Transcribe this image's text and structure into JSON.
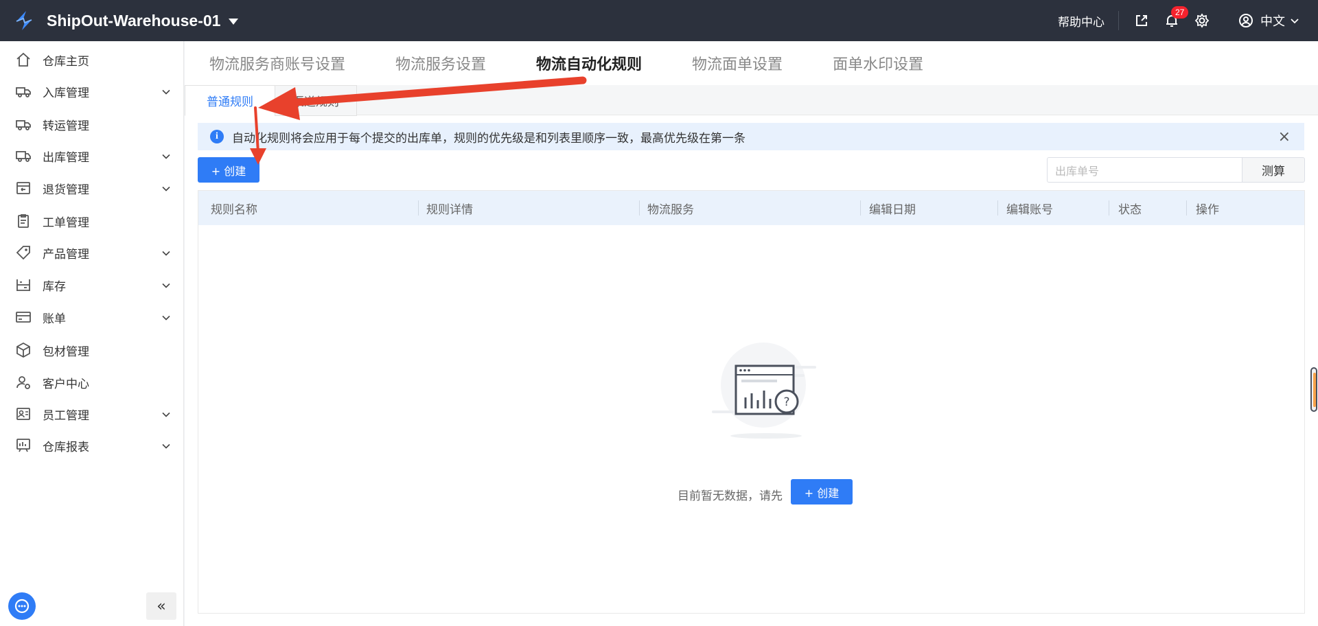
{
  "header": {
    "warehouse_name": "ShipOut-Warehouse-01",
    "help_center": "帮助中心",
    "notification_count": "27",
    "language": "中文"
  },
  "sidebar": {
    "items": [
      {
        "label": "仓库主页",
        "icon": "home-icon",
        "expandable": false
      },
      {
        "label": "入库管理",
        "icon": "inbound-truck-icon",
        "expandable": true
      },
      {
        "label": "转运管理",
        "icon": "transfer-truck-icon",
        "expandable": false
      },
      {
        "label": "出库管理",
        "icon": "outbound-truck-icon",
        "expandable": true
      },
      {
        "label": "退货管理",
        "icon": "return-box-icon",
        "expandable": true
      },
      {
        "label": "工单管理",
        "icon": "clipboard-icon",
        "expandable": false
      },
      {
        "label": "产品管理",
        "icon": "tag-icon",
        "expandable": true
      },
      {
        "label": "库存",
        "icon": "shelf-icon",
        "expandable": true
      },
      {
        "label": "账单",
        "icon": "card-icon",
        "expandable": true
      },
      {
        "label": "包材管理",
        "icon": "package-icon",
        "expandable": false
      },
      {
        "label": "客户中心",
        "icon": "user-gear-icon",
        "expandable": false
      },
      {
        "label": "员工管理",
        "icon": "staff-icon",
        "expandable": true
      },
      {
        "label": "仓库报表",
        "icon": "report-icon",
        "expandable": true
      }
    ],
    "collapse_label": "«"
  },
  "main": {
    "tabs": [
      {
        "label": "物流服务商账号设置",
        "active": false
      },
      {
        "label": "物流服务设置",
        "active": false
      },
      {
        "label": "物流自动化规则",
        "active": true
      },
      {
        "label": "物流面单设置",
        "active": false
      },
      {
        "label": "面单水印设置",
        "active": false
      }
    ],
    "sub_tabs": [
      {
        "label": "普通规则",
        "active": true
      },
      {
        "label": "渠道规则",
        "active": false
      }
    ],
    "alert_text": "自动化规则将会应用于每个提交的出库单，规则的优先级是和列表里顺序一致，最高优先级在第一条",
    "create_label": "+ 创建",
    "search_placeholder": "出库单号",
    "measure_label": "测算",
    "table": {
      "columns": [
        "规则名称",
        "规则详情",
        "物流服务",
        "编辑日期",
        "编辑账号",
        "状态",
        "操作"
      ]
    },
    "empty": {
      "text": "目前暂无数据，请先",
      "create_label": "+ 创建"
    }
  },
  "colors": {
    "primary": "#2f7cf6",
    "header_bg": "#2c313d",
    "annotation_arrow": "#e8412c"
  }
}
